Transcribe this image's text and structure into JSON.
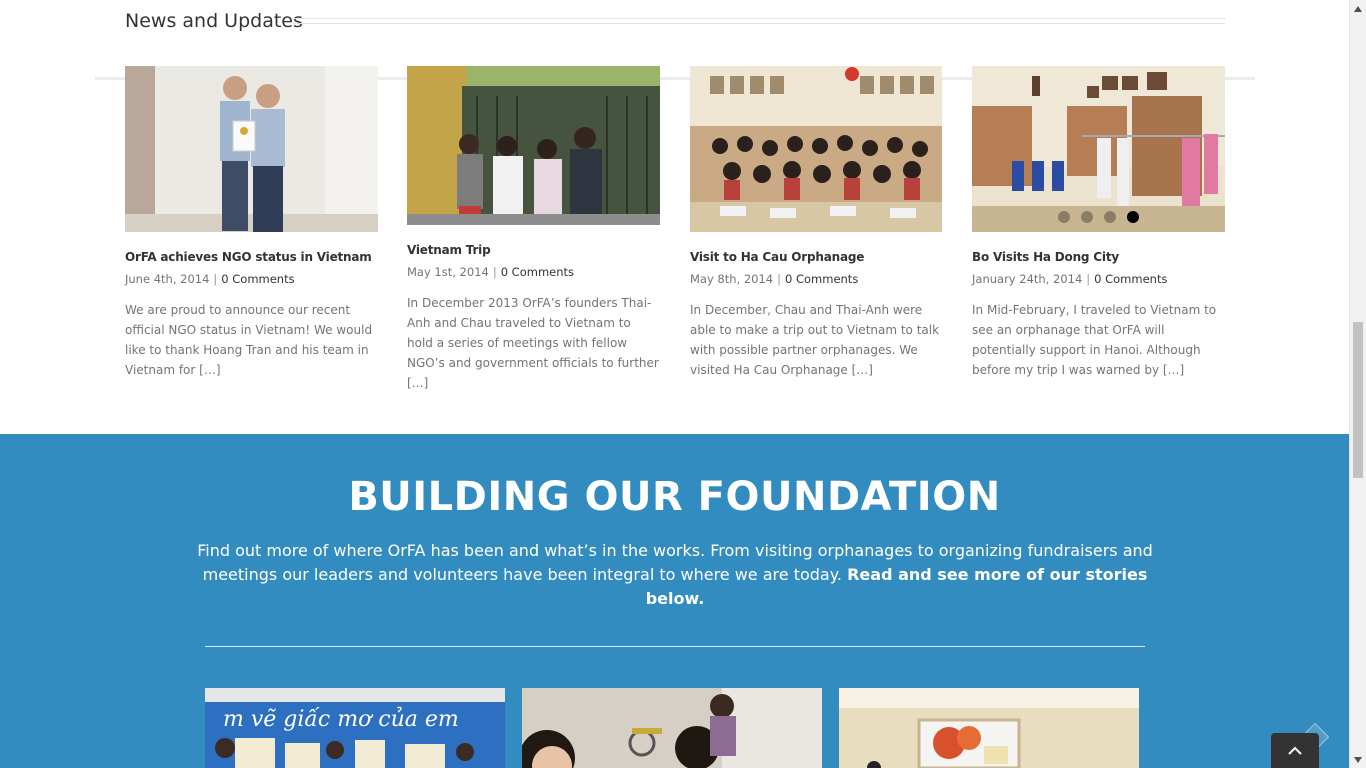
{
  "news": {
    "heading": "News and Updates",
    "posts": [
      {
        "title": "OrFA achieves NGO status in Vietnam",
        "date": "June 4th, 2014",
        "comments": "0 Comments",
        "excerpt": "We are proud to announce our recent official NGO status in Vietnam! We would like to thank Hoang Tran and his team in Vietnam for […]"
      },
      {
        "title": "Vietnam Trip",
        "date": "May 1st, 2014",
        "comments": "0 Comments",
        "excerpt": "In December 2013 OrFA’s founders Thai-Anh and Chau traveled to Vietnam to hold a series of meetings with fellow NGO’s and government officials to further […]"
      },
      {
        "title": "Visit to Ha Cau Orphanage",
        "date": "May 8th, 2014",
        "comments": "0 Comments",
        "excerpt": "In December, Chau and Thai-Anh were able to make a trip out to Vietnam to talk with possible partner orphanages. We visited Ha Cau Orphanage […]"
      },
      {
        "title": "Bo Visits Ha Dong City",
        "date": "January 24th, 2014",
        "comments": "0 Comments",
        "excerpt": "In Mid-February, I traveled to Vietnam to see an orphanage that OrFA will potentially support in Hanoi. Although before my trip I was warned by […]"
      }
    ],
    "separator": "|",
    "slider_dots": 4,
    "active_dot": 4
  },
  "foundation": {
    "title": "BUILDING OUR FOUNDATION",
    "text": "Find out more of where OrFA has been and what’s in the works. From visiting orphanages to organizing fundraisers and meetings our leaders and volunteers have been integral to where we are today.",
    "text_bold": "Read and see more of our stories below.",
    "image1_caption": "m vẽ giấc mơ của em"
  },
  "colors": {
    "foundation_bg": "#338cbf",
    "text_dark": "#333333",
    "text_muted": "#747474"
  },
  "icons": {
    "to_top": "chevron-up-icon"
  }
}
